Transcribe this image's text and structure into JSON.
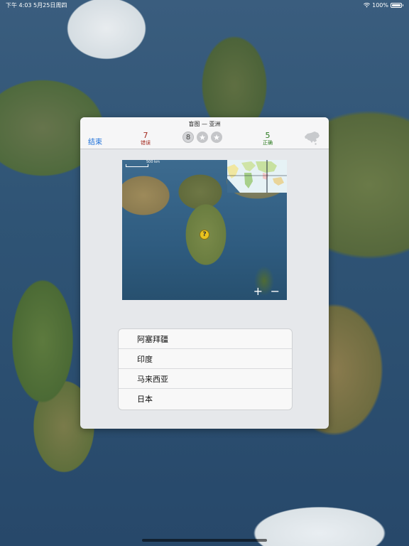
{
  "status_bar": {
    "time": "下午 4:03  5月25日周四",
    "battery": "100%"
  },
  "quiz": {
    "title": "盲图 — 亚洲",
    "end_label": "结束",
    "wrong": {
      "count": "7",
      "label": "错误"
    },
    "right": {
      "count": "5",
      "label": "正确"
    },
    "remaining": "8",
    "stars": 2
  },
  "map": {
    "scale": "500 km",
    "marker": "?",
    "zoom_in": "+",
    "zoom_out": "−"
  },
  "answers": [
    "阿塞拜疆",
    "印度",
    "马来西亚",
    "日本"
  ],
  "colors": {
    "accent": "#1a6ed8",
    "wrong": "#a3291f",
    "right": "#2a7a1e",
    "marker": "#e8c21e"
  },
  "icons": [
    "wifi-icon",
    "battery-icon",
    "star-icon",
    "asia-silhouette-icon",
    "question-marker-icon"
  ]
}
